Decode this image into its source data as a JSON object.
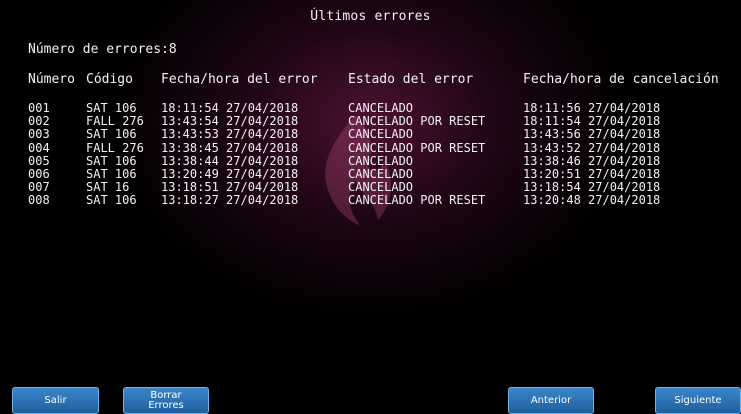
{
  "title": "Últimos errores",
  "count_label": "Número de errores:8",
  "columns": {
    "numero": "Número",
    "codigo": "Código",
    "fecha_error": "Fecha/hora del error",
    "estado": "Estado del error",
    "fecha_cancel": "Fecha/hora de cancelación"
  },
  "rows": [
    {
      "numero": "001",
      "codigo": "SAT 106",
      "fecha_error": "18:11:54 27/04/2018",
      "estado": "CANCELADO",
      "fecha_cancel": "18:11:56 27/04/2018"
    },
    {
      "numero": "002",
      "codigo": "FALL 276",
      "fecha_error": "13:43:54 27/04/2018",
      "estado": "CANCELADO POR RESET",
      "fecha_cancel": "18:11:54 27/04/2018"
    },
    {
      "numero": "003",
      "codigo": "SAT 106",
      "fecha_error": "13:43:53 27/04/2018",
      "estado": "CANCELADO",
      "fecha_cancel": "13:43:56 27/04/2018"
    },
    {
      "numero": "004",
      "codigo": "FALL 276",
      "fecha_error": "13:38:45 27/04/2018",
      "estado": "CANCELADO POR RESET",
      "fecha_cancel": "13:43:52 27/04/2018"
    },
    {
      "numero": "005",
      "codigo": "SAT 106",
      "fecha_error": "13:38:44 27/04/2018",
      "estado": "CANCELADO",
      "fecha_cancel": "13:38:46 27/04/2018"
    },
    {
      "numero": "006",
      "codigo": "SAT 106",
      "fecha_error": "13:20:49 27/04/2018",
      "estado": "CANCELADO",
      "fecha_cancel": "13:20:51 27/04/2018"
    },
    {
      "numero": "007",
      "codigo": "SAT 16",
      "fecha_error": "13:18:51 27/04/2018",
      "estado": "CANCELADO",
      "fecha_cancel": "13:18:54 27/04/2018"
    },
    {
      "numero": "008",
      "codigo": "SAT 106",
      "fecha_error": "13:18:27 27/04/2018",
      "estado": "CANCELADO POR RESET",
      "fecha_cancel": "13:20:48 27/04/2018"
    }
  ],
  "buttons": {
    "salir": "Salir",
    "borrar_line1": "Borrar",
    "borrar_line2": "Errores",
    "anterior": "Anterior",
    "siguiente": "Siguiente"
  },
  "colors": {
    "background": "#000000",
    "glow": "#5a143c",
    "text": "#f2f2f2",
    "button": "#2a74b6"
  },
  "icons": {
    "background_emblem": "flame-logo-icon"
  }
}
